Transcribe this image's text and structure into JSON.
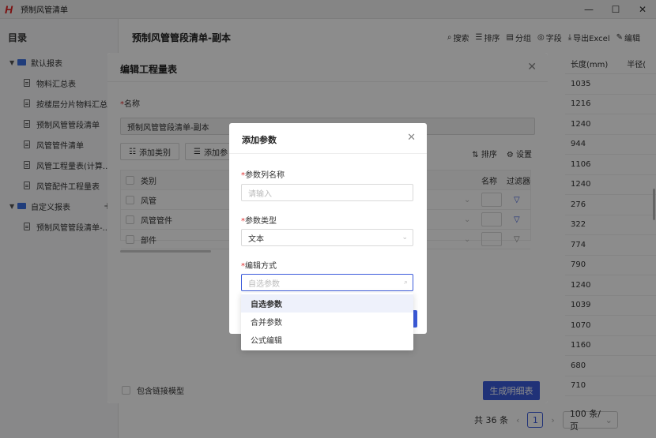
{
  "window": {
    "title": "预制风管清单",
    "logo": "H"
  },
  "sidebar": {
    "title": "目录",
    "groups": [
      {
        "label": "默认报表",
        "items": [
          "物料汇总表",
          "按楼层分片物料汇总表",
          "预制风管管段清单",
          "风管管件清单",
          "风管工程量表(计算...",
          "风管配件工程量表"
        ]
      },
      {
        "label": "自定义报表",
        "items": [
          "预制风管管段清单-..."
        ]
      }
    ],
    "plus": "+"
  },
  "main": {
    "title": "预制风管管段清单-副本",
    "toolbar": [
      "搜索",
      "排序",
      "分组",
      "字段",
      "导出Excel",
      "编辑"
    ],
    "columns": [
      "长度(mm)",
      "半径("
    ],
    "values": [
      "1035",
      "1216",
      "1240",
      "944",
      "1106",
      "1240",
      "276",
      "322",
      "774",
      "790",
      "1240",
      "1039",
      "1070",
      "1160",
      "680",
      "710"
    ]
  },
  "pager": {
    "total": "共 36 条",
    "current": "1",
    "size": "100 条/页"
  },
  "edit_dialog": {
    "title": "编辑工程量表",
    "name_label": "名称",
    "name_value": "预制风管管段清单-副本",
    "add_category": "添加类别",
    "add_param": "添加参",
    "sort": "排序",
    "settings": "设置",
    "col_category": "类别",
    "col_name": "名称",
    "col_filter": "过滤器",
    "rows": [
      "风管",
      "风管管件",
      "部件"
    ],
    "include_linked": "包含链接模型",
    "generate": "生成明细表"
  },
  "add_dialog": {
    "title": "添加参数",
    "param_name_label": "参数列名称",
    "param_name_placeholder": "请输入",
    "param_type_label": "参数类型",
    "param_type_value": "文本",
    "edit_mode_label": "编辑方式",
    "edit_mode_placeholder": "自选参数"
  },
  "dropdown": {
    "options": [
      "自选参数",
      "合并参数",
      "公式编辑"
    ],
    "selected": "自选参数"
  },
  "colors": {
    "accent": "#3b5bdb",
    "required": "#e03131"
  }
}
